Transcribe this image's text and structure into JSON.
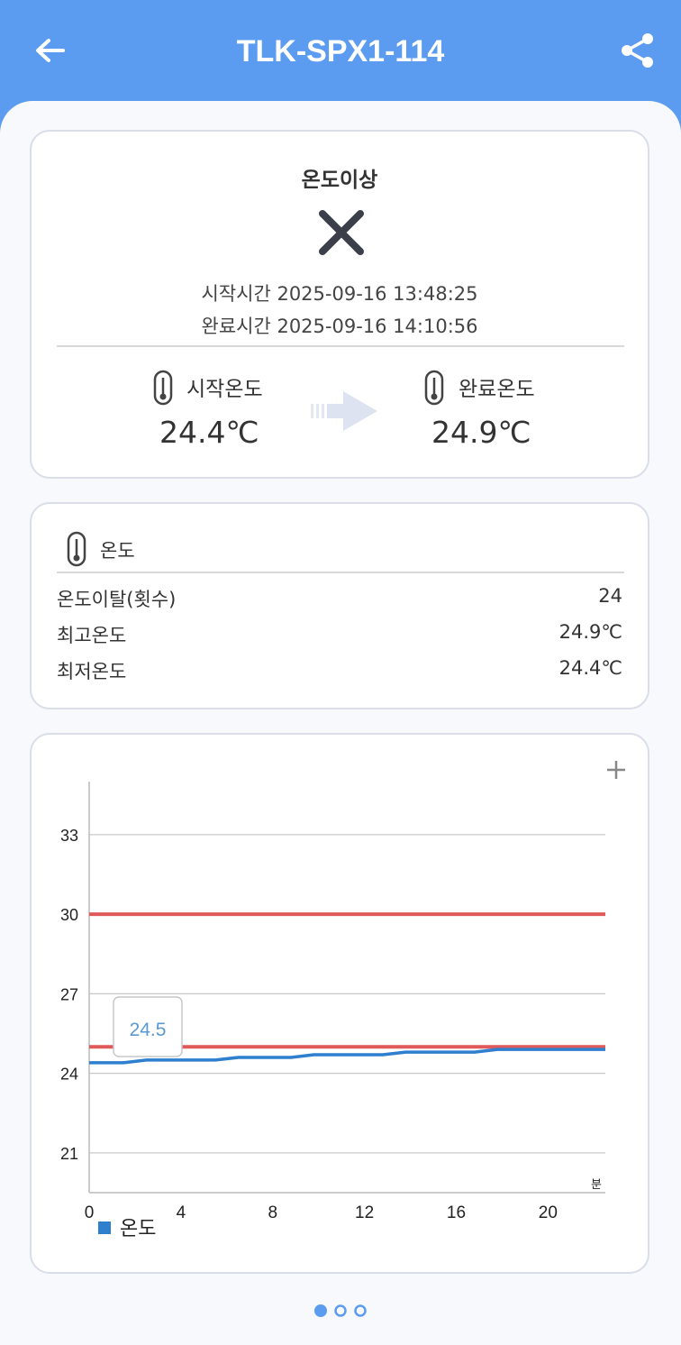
{
  "header": {
    "title": "TLK-SPX1-114",
    "back_icon": "arrow-left-icon",
    "share_icon": "share-icon"
  },
  "summary": {
    "status": "온도이상",
    "status_icon": "x-icon",
    "start_time": "시작시간 2025-09-16 13:48:25",
    "end_time": "완료시간 2025-09-16 14:10:56",
    "start_temp_label": "시작온도",
    "start_temp_value": "24.4℃",
    "end_temp_label": "완료온도",
    "end_temp_value": "24.9℃"
  },
  "stats": {
    "title": "온도",
    "rows": [
      {
        "label": "온도이탈(횟수)",
        "value": "24"
      },
      {
        "label": "최고온도",
        "value": "24.9℃"
      },
      {
        "label": "최저온도",
        "value": "24.4℃"
      }
    ]
  },
  "chart_data": {
    "type": "line",
    "x_unit_label": "분",
    "x_ticks": [
      0,
      4,
      8,
      12,
      16,
      20
    ],
    "y_ticks": [
      21,
      24,
      27,
      30,
      33
    ],
    "xlim": [
      0,
      22.5
    ],
    "ylim": [
      19.5,
      35
    ],
    "grid": true,
    "legend_position": "bottom-left",
    "tooltip": "24.5",
    "thresholds": [
      {
        "value": 30,
        "color": "#e05a5a"
      },
      {
        "value": 25,
        "color": "#e05a5a"
      }
    ],
    "series": [
      {
        "name": "온도",
        "color": "#2f7fcf",
        "x": [
          0,
          1.5,
          2.5,
          5.5,
          6.5,
          8.8,
          9.8,
          12.8,
          13.8,
          16.8,
          17.8,
          22.5
        ],
        "y": [
          24.4,
          24.4,
          24.5,
          24.5,
          24.6,
          24.6,
          24.7,
          24.7,
          24.8,
          24.8,
          24.9,
          24.9
        ]
      }
    ]
  },
  "pager": {
    "current": 1,
    "total": 3
  }
}
